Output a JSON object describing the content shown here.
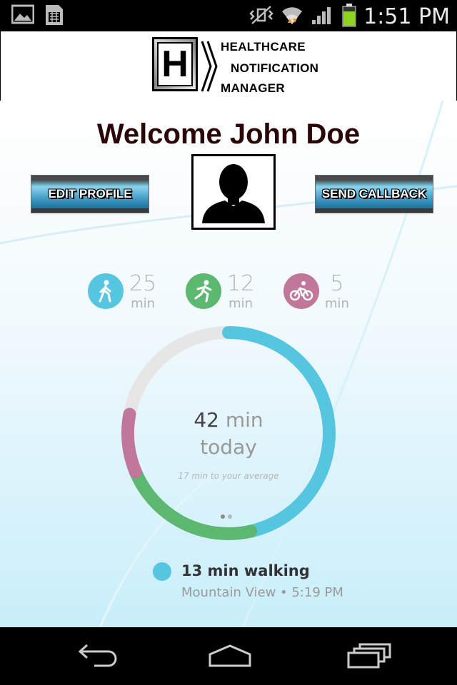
{
  "status_bar": {
    "time": "1:51 PM",
    "icons": [
      "image-icon",
      "sim-card-icon",
      "vibrate-mute-icon",
      "wifi-icon",
      "signal-icon",
      "battery-icon"
    ]
  },
  "header": {
    "logo_letter": "H",
    "brand_line1": "HEALTHCARE",
    "brand_line2": "NOTIFICATION",
    "brand_line3": "MANAGER"
  },
  "welcome_text": "Welcome John Doe",
  "buttons": {
    "edit_profile": "EDIT PROFILE",
    "send_callback": "SEND CALLBACK"
  },
  "activities": [
    {
      "icon": "walking-icon",
      "value": "25",
      "unit": "min",
      "color": "#56c6e0"
    },
    {
      "icon": "running-icon",
      "value": "12",
      "unit": "min",
      "color": "#5cb870"
    },
    {
      "icon": "cycling-icon",
      "value": "5",
      "unit": "min",
      "color": "#c0779a"
    }
  ],
  "ring": {
    "total_value": "42",
    "total_unit": "min",
    "period": "today",
    "note": "17 min to your average",
    "segments": {
      "walking": 25,
      "running": 12,
      "cycling": 5
    },
    "colors": {
      "walking": "#56c6e0",
      "running": "#5cb870",
      "cycling": "#c0779a",
      "track": "#e6e6e6"
    }
  },
  "recent": {
    "title": "13 min walking",
    "subtitle": "Mountain View • 5:19 PM"
  },
  "nav": [
    "back-icon",
    "home-icon",
    "recent-apps-icon"
  ]
}
